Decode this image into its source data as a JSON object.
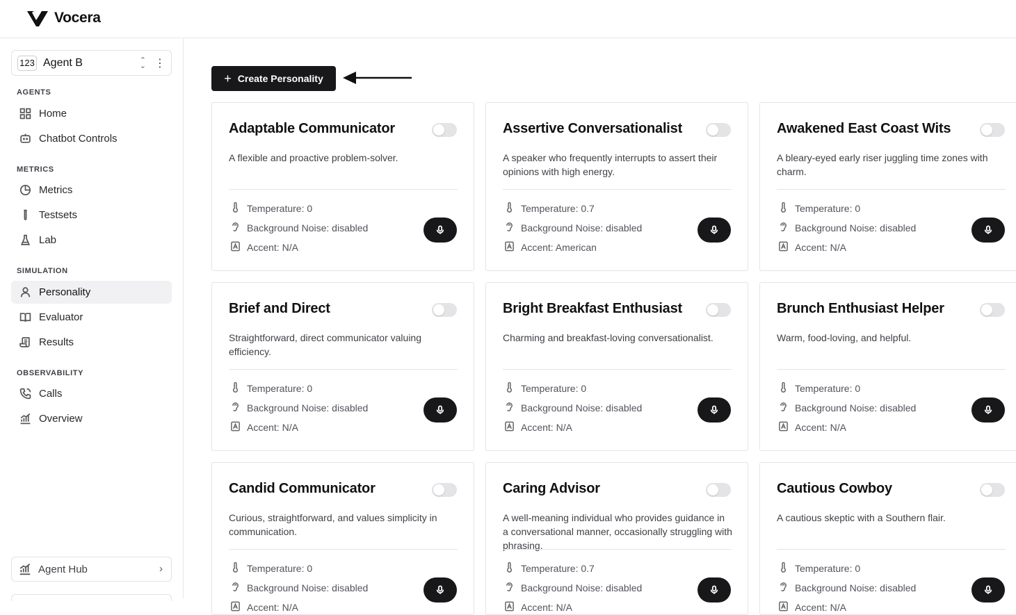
{
  "app": {
    "name": "Vocera"
  },
  "sidebar": {
    "agent": {
      "badge": "123",
      "name": "Agent B"
    },
    "sections": [
      {
        "label": "AGENTS",
        "items": [
          {
            "label": "Home",
            "icon": "grid-icon"
          },
          {
            "label": "Chatbot Controls",
            "icon": "bot-icon"
          }
        ]
      },
      {
        "label": "METRICS",
        "items": [
          {
            "label": "Metrics",
            "icon": "pie-chart-icon"
          },
          {
            "label": "Testsets",
            "icon": "test-tube-icon"
          },
          {
            "label": "Lab",
            "icon": "flask-icon"
          }
        ]
      },
      {
        "label": "SIMULATION",
        "items": [
          {
            "label": "Personality",
            "icon": "user-icon",
            "active": true
          },
          {
            "label": "Evaluator",
            "icon": "book-icon"
          },
          {
            "label": "Results",
            "icon": "scroll-icon"
          }
        ]
      },
      {
        "label": "OBSERVABILITY",
        "items": [
          {
            "label": "Calls",
            "icon": "phone-icon"
          },
          {
            "label": "Overview",
            "icon": "chart-icon"
          }
        ]
      }
    ],
    "agent_hub": "Agent Hub"
  },
  "main": {
    "create_button": "Create Personality",
    "cards": [
      {
        "title": "Adaptable Communicator",
        "desc": "A flexible and proactive problem-solver.",
        "temperature": "Temperature: 0",
        "noise": "Background Noise: disabled",
        "accent": "Accent: N/A"
      },
      {
        "title": "Assertive Conversationalist",
        "desc": "A speaker who frequently interrupts to assert their opinions with high energy.",
        "temperature": "Temperature: 0.7",
        "noise": "Background Noise: disabled",
        "accent": "Accent: American"
      },
      {
        "title": "Awakened East Coast Wits",
        "desc": "A bleary-eyed early riser juggling time zones with charm.",
        "temperature": "Temperature: 0",
        "noise": "Background Noise: disabled",
        "accent": "Accent: N/A"
      },
      {
        "title": "Brief and Direct",
        "desc": "Straightforward, direct communicator valuing efficiency.",
        "temperature": "Temperature: 0",
        "noise": "Background Noise: disabled",
        "accent": "Accent: N/A"
      },
      {
        "title": "Bright Breakfast Enthusiast",
        "desc": "Charming and breakfast-loving conversationalist.",
        "temperature": "Temperature: 0",
        "noise": "Background Noise: disabled",
        "accent": "Accent: N/A"
      },
      {
        "title": "Brunch Enthusiast Helper",
        "desc": "Warm, food-loving, and helpful.",
        "temperature": "Temperature: 0",
        "noise": "Background Noise: disabled",
        "accent": "Accent: N/A"
      },
      {
        "title": "Candid Communicator",
        "desc": "Curious, straightforward, and values simplicity in communication.",
        "temperature": "Temperature: 0",
        "noise": "Background Noise: disabled",
        "accent": "Accent: N/A"
      },
      {
        "title": "Caring Advisor",
        "desc": "A well-meaning individual who provides guidance in a conversational manner, occasionally struggling with phrasing.",
        "temperature": "Temperature: 0.7",
        "noise": "Background Noise: disabled",
        "accent": "Accent: N/A"
      },
      {
        "title": "Cautious Cowboy",
        "desc": "A cautious skeptic with a Southern flair.",
        "temperature": "Temperature: 0",
        "noise": "Background Noise: disabled",
        "accent": "Accent: N/A"
      }
    ]
  }
}
